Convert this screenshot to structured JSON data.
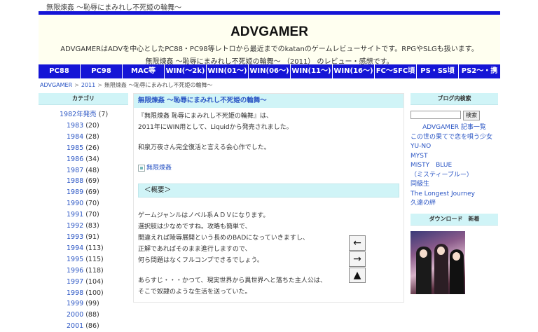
{
  "site": {
    "tab_title": "無限煉姦 ～恥辱にまみれし不死姫の輪舞～",
    "name": "ADVGAMER",
    "description": "ADVGAMERはADVを中心としたPC88・PC98等レトロから最近までのkatanのゲームレビューサイトです。RPGやSLGも扱います。",
    "subtitle": "無限煉姦 ～恥辱にまみれし不死姫の輪舞～ （2011） のレビュー・感想です。"
  },
  "nav": [
    "PC88",
    "PC98",
    "MAC等",
    "WIN(～2k)",
    "WIN(01～)",
    "WIN(06～)",
    "WIN(11～)",
    "WIN(16～)",
    "FC～SFC頃",
    "PS・SS頃",
    "PS2～・携"
  ],
  "breadcrumb": [
    "ADVGAMER",
    "2011",
    "無限煉姦 ～恥辱にまみれし不死姫の輪舞～"
  ],
  "left": {
    "heading": "カテゴリ",
    "categories": [
      {
        "label": "1982年発売",
        "count": "(7)"
      },
      {
        "label": "1983",
        "count": "(20)"
      },
      {
        "label": "1984",
        "count": "(28)"
      },
      {
        "label": "1985",
        "count": "(26)"
      },
      {
        "label": "1986",
        "count": "(34)"
      },
      {
        "label": "1987",
        "count": "(48)"
      },
      {
        "label": "1988",
        "count": "(69)"
      },
      {
        "label": "1989",
        "count": "(69)"
      },
      {
        "label": "1990",
        "count": "(70)"
      },
      {
        "label": "1991",
        "count": "(70)"
      },
      {
        "label": "1992",
        "count": "(83)"
      },
      {
        "label": "1993",
        "count": "(91)"
      },
      {
        "label": "1994",
        "count": "(113)"
      },
      {
        "label": "1995",
        "count": "(115)"
      },
      {
        "label": "1996",
        "count": "(118)"
      },
      {
        "label": "1997",
        "count": "(104)"
      },
      {
        "label": "1998",
        "count": "(100)"
      },
      {
        "label": "1999",
        "count": "(99)"
      },
      {
        "label": "2000",
        "count": "(88)"
      },
      {
        "label": "2001",
        "count": "(86)"
      }
    ]
  },
  "main": {
    "title": "無限煉姦 ～恥辱にまみれし不死姫の輪舞～",
    "intro1": "『無限煉姦 恥辱にまみれし不死姫の輪舞』は、",
    "intro2": "2011年にWIN用として、Liquidから発売されました。",
    "intro3": "和泉万夜さん完全復活と言える会心作でした。",
    "image_alt": "無限煉姦",
    "section": "＜概要＞",
    "body": [
      "ゲームジャンルはノベル系ＡＤＶになります。",
      "選択肢は少なめですね。攻略も簡単で、",
      "間違えれば陵辱展開という長めのBADになっていきますし、",
      "正解であればそのまま進行しますので、",
      "何ら問題はなくフルコンプできるでしょう。"
    ],
    "story": [
      "あらすじ・・・かつて、現実世界から異世界へと落ちた主人公は、",
      "そこで奴隷のような生活を送っていた。"
    ]
  },
  "float_buttons": [
    "←",
    "→",
    "▲"
  ],
  "right": {
    "search_heading": "ブログ内検索",
    "search_button": "検索",
    "search_placeholder": "",
    "links": [
      "ADVGAMER 記事一覧",
      "この世の果てで恋を唄う少女",
      "YU-NO",
      "MYST",
      "MISTY　BLUE",
      "（ミスティーブルー）",
      "同級生",
      "The Longest Journey",
      "久遠の絆"
    ],
    "download_heading": "ダウンロード　新着"
  }
}
